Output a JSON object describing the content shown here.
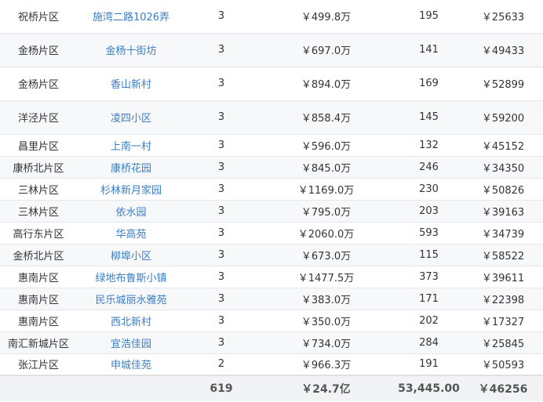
{
  "rows": [
    {
      "district": "祝桥片区",
      "community": "施湾二路1026弄",
      "count": "3",
      "total_price": "￥499.8万",
      "area": "195",
      "unit_price": "￥25633"
    },
    {
      "district": "金杨片区",
      "community": "金杨十街坊",
      "count": "3",
      "total_price": "￥697.0万",
      "area": "141",
      "unit_price": "￥49433"
    },
    {
      "district": "金杨片区",
      "community": "香山新村",
      "count": "3",
      "total_price": "￥894.0万",
      "area": "169",
      "unit_price": "￥52899"
    },
    {
      "district": "洋泾片区",
      "community": "凌四小区",
      "count": "3",
      "total_price": "￥858.4万",
      "area": "145",
      "unit_price": "￥59200"
    },
    {
      "district": "昌里片区",
      "community": "上南一村",
      "count": "3",
      "total_price": "￥596.0万",
      "area": "132",
      "unit_price": "￥45152"
    },
    {
      "district": "康桥北片区",
      "community": "康桥花园",
      "count": "3",
      "total_price": "￥845.0万",
      "area": "246",
      "unit_price": "￥34350"
    },
    {
      "district": "三林片区",
      "community": "杉林新月家园",
      "count": "3",
      "total_price": "￥1169.0万",
      "area": "230",
      "unit_price": "￥50826"
    },
    {
      "district": "三林片区",
      "community": "依水园",
      "count": "3",
      "total_price": "￥795.0万",
      "area": "203",
      "unit_price": "￥39163"
    },
    {
      "district": "高行东片区",
      "community": "华高苑",
      "count": "3",
      "total_price": "￥2060.0万",
      "area": "593",
      "unit_price": "￥34739"
    },
    {
      "district": "金桥北片区",
      "community": "柳埠小区",
      "count": "3",
      "total_price": "￥673.0万",
      "area": "115",
      "unit_price": "￥58522"
    },
    {
      "district": "惠南片区",
      "community": "绿地布鲁斯小镇",
      "count": "3",
      "total_price": "￥1477.5万",
      "area": "373",
      "unit_price": "￥39611"
    },
    {
      "district": "惠南片区",
      "community": "民乐城丽水雅苑",
      "count": "3",
      "total_price": "￥383.0万",
      "area": "171",
      "unit_price": "￥22398"
    },
    {
      "district": "惠南片区",
      "community": "西北新村",
      "count": "3",
      "total_price": "￥350.0万",
      "area": "202",
      "unit_price": "￥17327"
    },
    {
      "district": "南汇新城片区",
      "community": "宜浩佳园",
      "count": "3",
      "total_price": "￥734.0万",
      "area": "284",
      "unit_price": "￥25845"
    },
    {
      "district": "张江片区",
      "community": "申城佳苑",
      "count": "2",
      "total_price": "￥966.3万",
      "area": "191",
      "unit_price": "￥50593"
    }
  ],
  "totals": {
    "district": "",
    "community": "",
    "count": "619",
    "total_price": "￥24.7亿",
    "area": "53,445.00",
    "unit_price": "￥46256"
  },
  "colors": {
    "link": "#3a7ec4",
    "text": "#333333",
    "row_alt": "#f7f8fa",
    "footer_bg": "#f2f3f5"
  }
}
